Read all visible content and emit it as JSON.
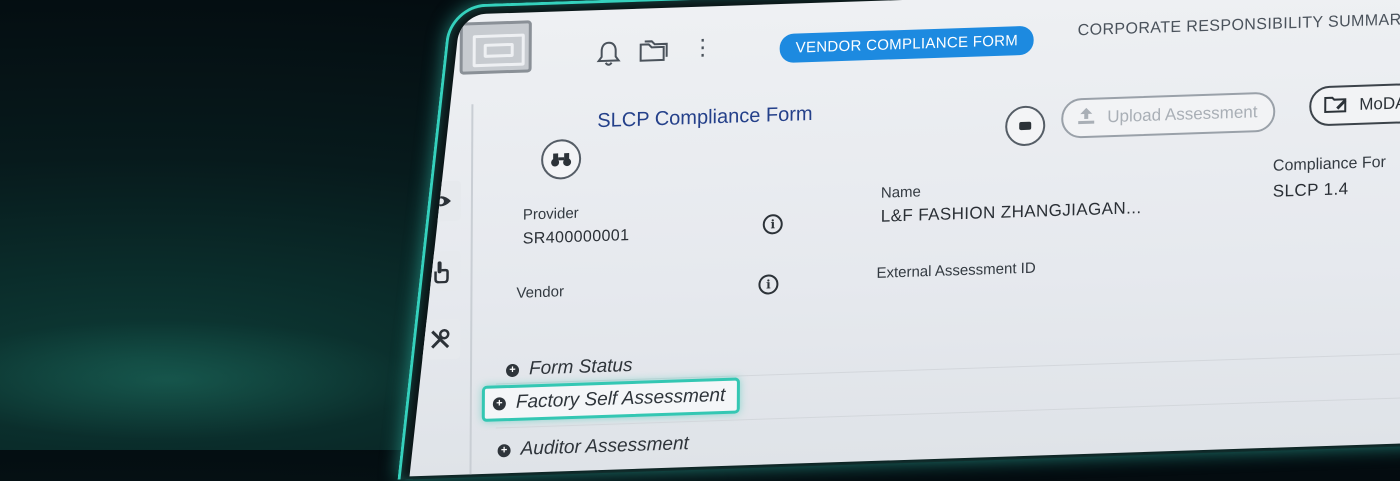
{
  "header": {
    "logo_icon": "app-logo",
    "bell_icon": "bell-icon",
    "folder_icon": "folder-icon",
    "more_icon": "more-vertical-icon",
    "active_tab_label": "VENDOR COMPLIANCE FORM",
    "tab2_label": "CORPORATE RESPONSIBILITY SUMMARY",
    "accent_color": "#1d8ae0"
  },
  "sidebar": {
    "expand_icon": "chevron-right-icon",
    "items": [
      {
        "icon": "eye-icon"
      },
      {
        "icon": "touch-pointer-icon"
      },
      {
        "icon": "tools-icon"
      }
    ]
  },
  "form": {
    "title": "SLCP Compliance Form",
    "binoculars_icon": "binoculars-icon",
    "upload_label": "Upload Assessment",
    "moda_label": "MoDA",
    "fields": {
      "provider_label": "Provider",
      "provider_value": "SR400000001",
      "name_label": "Name",
      "name_value": "L&F FASHION ZHANGJIAGAN...",
      "compliance_label": "Compliance For",
      "compliance_value": "SLCP 1.4",
      "vendor_label": "Vendor",
      "external_id_label": "External Assessment ID"
    },
    "sections": [
      {
        "label": "Form Status"
      },
      {
        "label": "Factory Self Assessment"
      },
      {
        "label": "Auditor Assessment"
      }
    ],
    "highlight_color": "#34c7b3"
  }
}
